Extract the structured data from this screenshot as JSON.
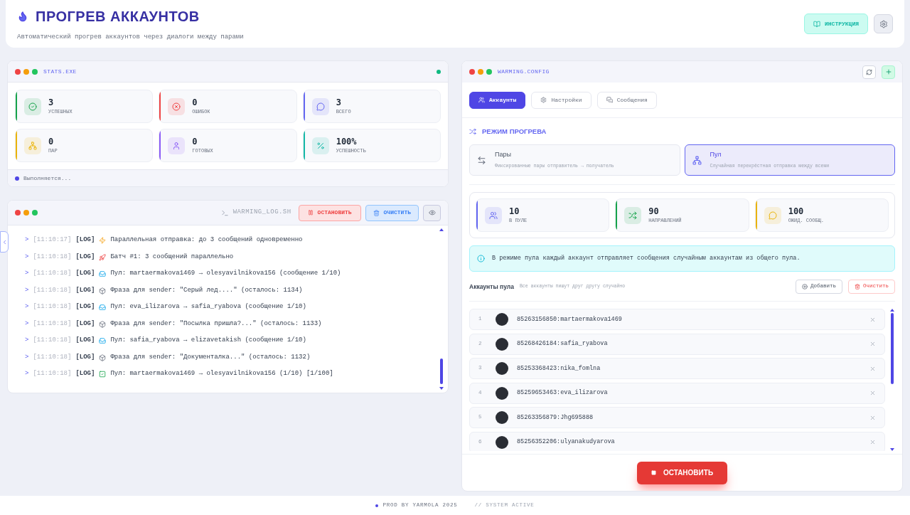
{
  "header": {
    "title": "ПРОГРЕВ АККАУНТОВ",
    "subtitle": "Автоматический прогрев аккаунтов через диалоги между парами",
    "guide_button": "ИНСТРУКЦИЯ"
  },
  "stats": {
    "title": "STATS.EXE",
    "online": true,
    "status": "Выполняется...",
    "cards": [
      {
        "kind": "success",
        "value": "3",
        "label": "УСПЕШНЫХ",
        "color": "#16a34a"
      },
      {
        "kind": "error",
        "value": "0",
        "label": "ОШИБОК",
        "color": "#ef4444"
      },
      {
        "kind": "messages",
        "value": "3",
        "label": "ВСЕГО",
        "color": "#6366f1"
      },
      {
        "kind": "pairs",
        "value": "0",
        "label": "ПАР",
        "color": "#eab308"
      },
      {
        "kind": "ready",
        "value": "0",
        "label": "ГОТОВЫХ",
        "color": "#8b5cf6"
      },
      {
        "kind": "percent",
        "value": "100%",
        "label": "УСПЕШНОСТЬ",
        "color": "#14b8a6"
      }
    ]
  },
  "log": {
    "title": "WARMING_LOG.SH",
    "stop_button": "ОСТАНОВИТЬ",
    "clear_button": "ОЧИСТИТЬ",
    "entries": [
      {
        "prompt": ">",
        "time": "[11:10:17]",
        "tag": "[LOG]",
        "kind": "parallel",
        "text": "Параллельная отправка: до 3 сообщений одновременно"
      },
      {
        "prompt": ">",
        "time": "[11:10:18]",
        "tag": "[LOG]",
        "kind": "batch",
        "text": "Батч #1: 3 сообщений параллельно"
      },
      {
        "prompt": ">",
        "time": "[11:10:18]",
        "tag": "[LOG]",
        "kind": "send",
        "text": "Пул: martaermakova1469 → olesyavilnikova156 (сообщение 1/10)"
      },
      {
        "prompt": ">",
        "time": "[11:10:18]",
        "tag": "[LOG]",
        "kind": "phrase",
        "text": "Фраза для sender: \"Серый лед....\" (осталось: 1134)"
      },
      {
        "prompt": ">",
        "time": "[11:10:18]",
        "tag": "[LOG]",
        "kind": "send",
        "text": "Пул: eva_ilizarova → safia_ryabova (сообщение 1/10)"
      },
      {
        "prompt": ">",
        "time": "[11:10:18]",
        "tag": "[LOG]",
        "kind": "phrase",
        "text": "Фраза для sender: \"Посылка пришла?...\" (осталось: 1133)"
      },
      {
        "prompt": ">",
        "time": "[11:10:18]",
        "tag": "[LOG]",
        "kind": "send",
        "text": "Пул: safia_ryabova → elizavetakish (сообщение 1/10)"
      },
      {
        "prompt": ">",
        "time": "[11:10:18]",
        "tag": "[LOG]",
        "kind": "phrase",
        "text": "Фраза для sender: \"Документалка...\" (осталось: 1132)"
      },
      {
        "prompt": ">",
        "time": "[11:10:18]",
        "tag": "[LOG]",
        "kind": "done",
        "text": "Пул: martaermakova1469 → olesyavilnikova156 (1/10) [1/100]"
      }
    ]
  },
  "config": {
    "title": "WARMING.CONFIG",
    "tabs": [
      {
        "kind": "accounts",
        "label": "Аккаунты",
        "selected": true
      },
      {
        "kind": "settings",
        "label": "Настройки",
        "selected": false
      },
      {
        "kind": "messages",
        "label": "Сообщения",
        "selected": false
      }
    ],
    "mode_title": "РЕЖИМ ПРОГРЕВА",
    "modes": [
      {
        "kind": "pairs",
        "name": "Пары",
        "description": "Фиксированные пары отправитель → получатель",
        "selected": false
      },
      {
        "kind": "pool",
        "name": "Пул",
        "description": "Случайная перекрёстная отправка между всеми",
        "selected": true
      }
    ],
    "pool_stats": [
      {
        "kind": "users",
        "value": "10",
        "label": "В ПУЛЕ",
        "color": "#6366f1"
      },
      {
        "kind": "shuffle",
        "value": "90",
        "label": "НАПРАВЛЕНИЙ",
        "color": "#16a34a"
      },
      {
        "kind": "chat",
        "value": "100",
        "label": "ОЖИД. СООБЩ.",
        "color": "#eab308"
      }
    ],
    "info": "В режиме пула каждый аккаунт отправляет сообщения случайным аккаунтам из общего пула.",
    "pool_title": "Аккаунты пула",
    "pool_hint": "Все аккаунты пишут друг другу случайно",
    "add_button": "Добавить",
    "clear_button": "Очистить",
    "accounts": [
      {
        "number": "1",
        "name": "85263156850:martaermakova1469"
      },
      {
        "number": "2",
        "name": "85268426184:safia_ryabova"
      },
      {
        "number": "3",
        "name": "85253368423:nika_fomlna"
      },
      {
        "number": "4",
        "name": "85259653463:eva_ilizarova"
      },
      {
        "number": "5",
        "name": "85263356879:Jhg695888"
      },
      {
        "number": "6",
        "name": "85256352206:ulyanakudyarova"
      }
    ],
    "stop_button": "ОСТАНОВИТЬ"
  },
  "footer": {
    "credit": "PROD BY YARMOLA 2025",
    "system": "// SYSTEM ACTIVE"
  }
}
